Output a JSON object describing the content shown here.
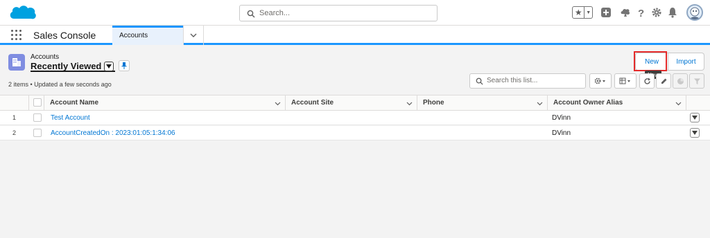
{
  "header": {
    "search_placeholder": "Search...",
    "favorites_icon": "star-icon",
    "icons": [
      "add-icon",
      "trailhead-icon",
      "help-icon",
      "setup-gear-icon",
      "notifications-bell-icon"
    ]
  },
  "nav": {
    "app_name": "Sales Console",
    "tab_label": "Accounts"
  },
  "list_view": {
    "object_label": "Accounts",
    "title": "Recently Viewed",
    "status": "2 items • Updated a few seconds ago",
    "new_label": "New",
    "import_label": "Import",
    "tooltip": "New",
    "search_placeholder": "Search this list..."
  },
  "table": {
    "columns": [
      "Account Name",
      "Account Site",
      "Phone",
      "Account Owner Alias"
    ],
    "rows": [
      {
        "num": "1",
        "account_name": "Test Account",
        "account_site": "",
        "phone": "",
        "owner": "DVinn"
      },
      {
        "num": "2",
        "account_name": "AccountCreatedOn : 2023:01:05:1:34:06",
        "account_site": "",
        "phone": "",
        "owner": "DVinn"
      }
    ]
  },
  "colors": {
    "brand_blue": "#0176d3",
    "active_bar": "#1b96ff",
    "accounts_icon": "#7f8de1",
    "highlight_red": "#e52b2b"
  }
}
